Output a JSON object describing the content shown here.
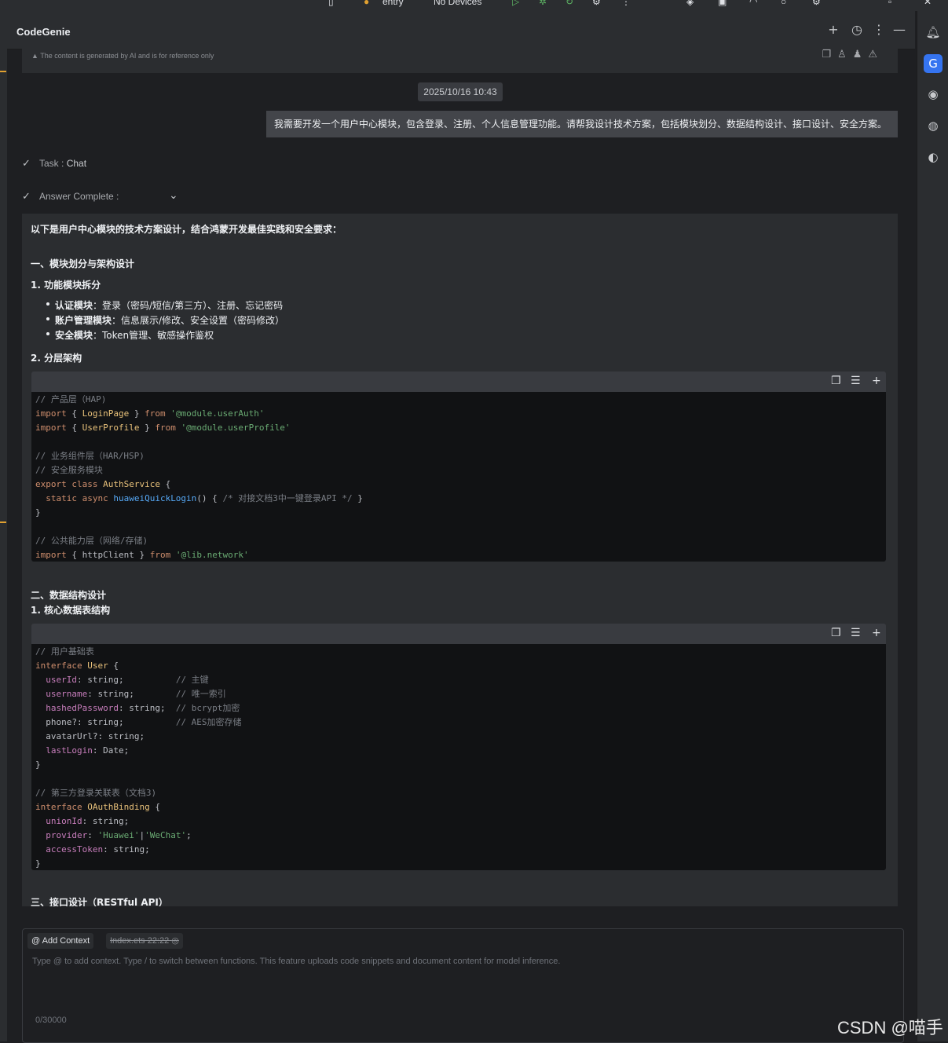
{
  "topbar": {
    "entry_label": "entry",
    "device_label": "No Devices"
  },
  "panel": {
    "title": "CodeGenie",
    "disclaimer": "The content is generated by AI and is for reference only"
  },
  "chat": {
    "timestamp": "2025/10/16 10:43",
    "user_message": "我需要开发一个用户中心模块，包含登录、注册、个人信息管理功能。请帮我设计技术方案，包括模块划分、数据结构设计、接口设计、安全方案。",
    "task_label": "Task :",
    "task_value": "Chat",
    "answer_status": "Answer Complete :"
  },
  "answer": {
    "intro": "以下是用户中心模块的技术方案设计，结合鸿蒙开发最佳实践和安全要求：",
    "section1_title": "一、模块划分与架构设计",
    "sub1_title": "1. 功能模块拆分",
    "bullets": [
      {
        "bold": "认证模块",
        "text": "：登录（密码/短信/第三方）、注册、忘记密码"
      },
      {
        "bold": "账户管理模块",
        "text": "：信息展示/修改、安全设置（密码修改）"
      },
      {
        "bold": "安全模块",
        "text": "：Token管理、敏感操作鉴权"
      }
    ],
    "sub2_title": "2. 分层架构",
    "code1": {
      "c1": "// 产品层（HAP)",
      "l2_import": "import",
      "l2_open": " { ",
      "l2_name": "LoginPage",
      "l2_close": " } ",
      "l2_from": "from",
      "l2_str": " '@module.userAuth'",
      "l3_import": "import",
      "l3_open": " { ",
      "l3_name": "UserProfile",
      "l3_close": " } ",
      "l3_from": "from",
      "l3_str": " '@module.userProfile'",
      "c5": "// 业务组件层（HAR/HSP)",
      "c6": "// 安全服务模块",
      "l7_export": "export class",
      "l7_name": " AuthService",
      "l7_brace": " {",
      "l8_static": "  static async",
      "l8_fn": " huaweiQuickLogin",
      "l8_par": "() { ",
      "l8_cm": "/* 对接文档3中一键登录API */",
      "l8_close": " }",
      "l9": "}",
      "c11": "// 公共能力层（网络/存储)",
      "l12_import": "import",
      "l12_open": " { ",
      "l12_name": "httpClient",
      "l12_close": " } ",
      "l12_from": "from",
      "l12_str": " '@lib.network'"
    },
    "section2_title": "二、数据结构设计",
    "sub3_title": "1. 核心数据表结构",
    "code2": {
      "c1": "// 用户基础表",
      "l2_kw": "interface",
      "l2_name": " User",
      "l2_brace": " {",
      "f1": "  userId",
      "f1_t": ": string;",
      "f1_cm": "          // 主键",
      "f2": "  username",
      "f2_t": ": string;",
      "f2_cm": "        // 唯一索引",
      "f3": "  hashedPassword",
      "f3_t": ": string;",
      "f3_cm": "  // bcrypt加密",
      "f4": "  phone?",
      "f4_t": ": string;",
      "f4_cm": "          // AES加密存储",
      "f5": "  avatarUrl?",
      "f5_t": ": string;",
      "f6": "  lastLogin",
      "f6_t": ": Date;",
      "close1": "}",
      "c2": "// 第三方登录关联表（文档3)",
      "l12_kw": "interface",
      "l12_name": " OAuthBinding",
      "l12_brace": " {",
      "g1": "  unionId",
      "g1_t": ": string;",
      "g2": "  provider",
      "g2_t": ": ",
      "g2_s1": "'Huawei'",
      "g2_bar": "|",
      "g2_s2": "'WeChat'",
      "g2_end": ";",
      "g3": "  accessToken",
      "g3_t": ": string;",
      "close2": "}"
    },
    "section3_title": "三、接口设计（RESTful API）"
  },
  "input": {
    "add_context": "@ Add Context",
    "file_chip": "Index.ets 22:22",
    "placeholder": "Type @ to add context. Type / to switch between functions. This feature uploads code snippets and document content for model inference.",
    "counter": "0/30000"
  },
  "watermark": "CSDN @喵手"
}
